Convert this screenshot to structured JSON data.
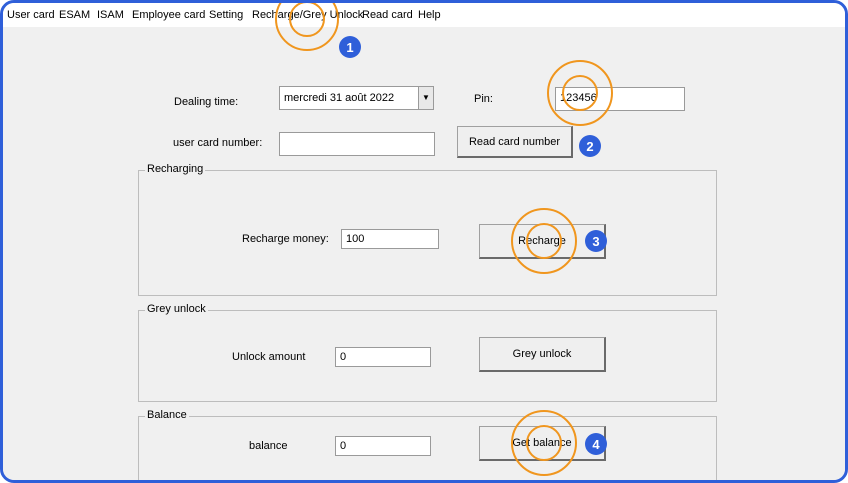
{
  "menu": {
    "user_card": "User card",
    "esam": "ESAM",
    "isam": "ISAM",
    "employee_card": "Employee card",
    "setting": "Setting",
    "recharge_grey_unlock": "Recharge/Grey Unlock",
    "read_card": "Read card",
    "help": "Help"
  },
  "form": {
    "dealing_time_label": "Dealing time:",
    "dealing_time_value": "mercredi  31      août      2022",
    "pin_label": "Pin:",
    "pin_value": "123456",
    "user_card_number_label": "user card number:",
    "user_card_number_value": "",
    "read_card_number_button": "Read card number"
  },
  "recharging": {
    "title": "Recharging",
    "money_label": "Recharge money:",
    "money_value": "100",
    "button": "Recharge"
  },
  "grey_unlock": {
    "title": "Grey unlock",
    "amount_label": "Unlock amount",
    "amount_value": "0",
    "button": "Grey unlock"
  },
  "balance": {
    "title": "Balance",
    "label": "balance",
    "value": "0",
    "button": "Get balance"
  },
  "annotations": {
    "step1": "1",
    "step2": "2",
    "step3": "3",
    "step4": "4",
    "ring_color": "#f0961e",
    "badge_color": "#2f5fd9"
  },
  "icons": {
    "date_dropdown": "caret-down-icon"
  }
}
